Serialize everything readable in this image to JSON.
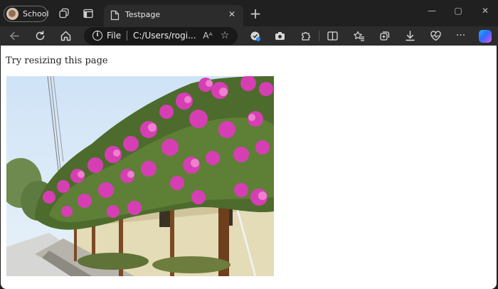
{
  "window": {
    "profile_label": "School",
    "tab_title": "Testpage",
    "tab_close_glyph": "✕",
    "new_tab_glyph": "+",
    "minimize_glyph": "—",
    "maximize_glyph": "▢",
    "close_glyph": "✕"
  },
  "toolbar": {
    "scheme": "File",
    "url": "C:/Users/rogi...",
    "read_aloud_glyph": "Aᴬ",
    "favorite_glyph": "☆",
    "more_glyph": "···"
  },
  "page": {
    "text": "Try resizing this page",
    "image_desc": "Bougainvillea flowers over a fence along a sidewalk"
  },
  "colors": {
    "chrome_dark": "#202020",
    "toolbar": "#2c2c2c",
    "page_bg": "#ffffff",
    "flower_magenta": "#d63fb3"
  },
  "icons": [
    "back-icon",
    "refresh-icon",
    "home-icon",
    "info-icon",
    "read-aloud-icon",
    "favorite-icon",
    "extension-icon",
    "split-screen-icon",
    "favorites-icon",
    "collections-icon",
    "downloads-icon",
    "performance-icon",
    "more-icon",
    "copilot-icon"
  ]
}
